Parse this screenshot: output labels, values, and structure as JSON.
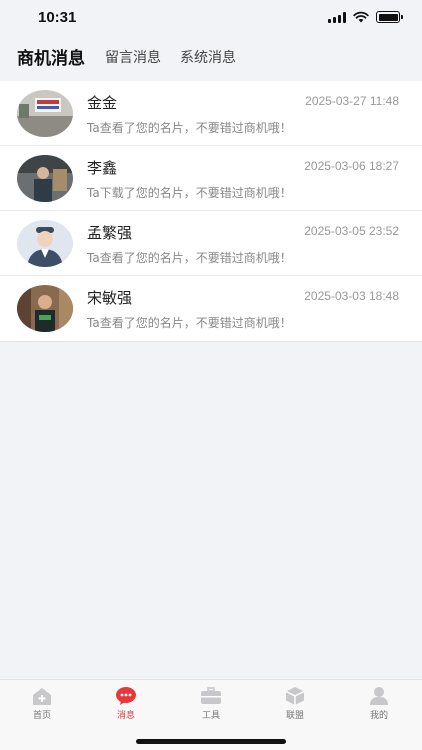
{
  "status_bar": {
    "time": "10:31"
  },
  "tabs": [
    {
      "label": "商机消息",
      "active": true
    },
    {
      "label": "留言消息",
      "active": false
    },
    {
      "label": "系统消息",
      "active": false
    }
  ],
  "messages": [
    {
      "name": "金金",
      "time": "2025-03-27 11:48",
      "text": "Ta查看了您的名片，不要错过商机哦！"
    },
    {
      "name": "李鑫",
      "time": "2025-03-06 18:27",
      "text": "Ta下载了您的名片，不要错过商机哦！"
    },
    {
      "name": "孟繁强",
      "time": "2025-03-05 23:52",
      "text": "Ta查看了您的名片，不要错过商机哦！"
    },
    {
      "name": "宋敏强",
      "time": "2025-03-03 18:48",
      "text": "Ta查看了您的名片，不要错过商机哦！"
    }
  ],
  "tabbar": [
    {
      "label": "首页",
      "icon": "home-icon",
      "active": false
    },
    {
      "label": "消息",
      "icon": "message-icon",
      "active": true
    },
    {
      "label": "工具",
      "icon": "toolbox-icon",
      "active": false
    },
    {
      "label": "联盟",
      "icon": "cube-icon",
      "active": false
    },
    {
      "label": "我的",
      "icon": "user-icon",
      "active": false
    }
  ],
  "colors": {
    "accent": "#e8373a",
    "inactive": "#c8c8cc",
    "background": "#f2f3f7"
  }
}
